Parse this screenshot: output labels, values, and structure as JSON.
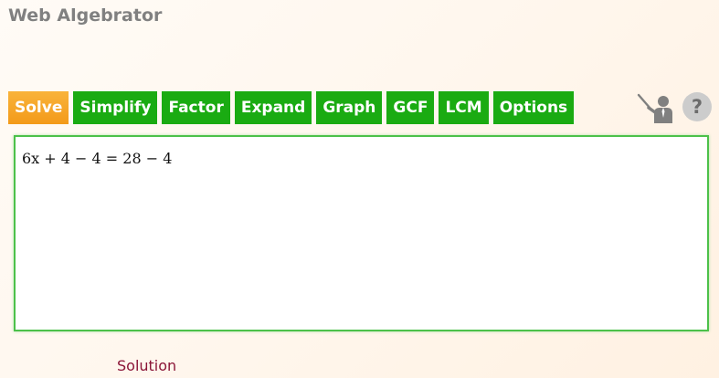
{
  "app": {
    "title": "Web Algebrator"
  },
  "toolbar": {
    "buttons": [
      {
        "label": "Solve",
        "active": true
      },
      {
        "label": "Simplify",
        "active": false
      },
      {
        "label": "Factor",
        "active": false
      },
      {
        "label": "Expand",
        "active": false
      },
      {
        "label": "Graph",
        "active": false
      },
      {
        "label": "GCF",
        "active": false
      },
      {
        "label": "LCM",
        "active": false
      },
      {
        "label": "Options",
        "active": false
      }
    ],
    "teacher_icon": "teacher-presenter-icon",
    "help_icon": "help-question-icon",
    "help_label": "?"
  },
  "editor": {
    "expression": "6x + 4 − 4 = 28 − 4"
  },
  "solution": {
    "label": "Solution"
  },
  "colors": {
    "active_button": "#f5a623",
    "button": "#1aab12",
    "editor_border": "#4cc14a",
    "title": "#808080",
    "solution_label": "#8b1638"
  }
}
